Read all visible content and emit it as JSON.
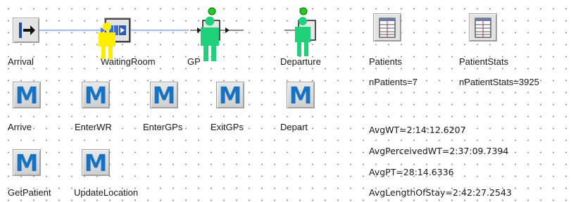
{
  "model_blocks": {
    "arrival": "Arrival",
    "waiting_room": "WaitingRoom",
    "gp": "GP",
    "departure": "Departure"
  },
  "tables": {
    "patients": "Patients",
    "patient_stats": "PatientStats",
    "n_patients": "nPatients=7",
    "n_patient_stats": "nPatientStats=3925"
  },
  "methods": {
    "arrive": "Arrive",
    "enter_wr": "EnterWR",
    "enter_gps": "EnterGPs",
    "exit_gps": "ExitGPs",
    "depart": "Depart",
    "get_patient": "GetPatient",
    "update_location": "UpdateLocation",
    "icon_letter": "M"
  },
  "statistics": {
    "avg_wt": "AvgWT=2:14:12.6207",
    "avg_perceived_wt": "AvgPerceivedWT=2:37:09.7394",
    "avg_pt": "AvgPT=28:14.6336",
    "avg_length_of_stay": "AvgLengthOfStay=2:42:27.2543"
  },
  "colors": {
    "method_blue": "#1673c4",
    "person_yellow": "#ffee00",
    "person_green": "#1fd27a",
    "indicator_green": "#22cc22",
    "flow_line": "#4a78d6"
  },
  "icons": [
    "arrival-icon",
    "queue-icon",
    "server-icon",
    "exit-icon",
    "table-icon",
    "method-icon",
    "person-icon"
  ]
}
